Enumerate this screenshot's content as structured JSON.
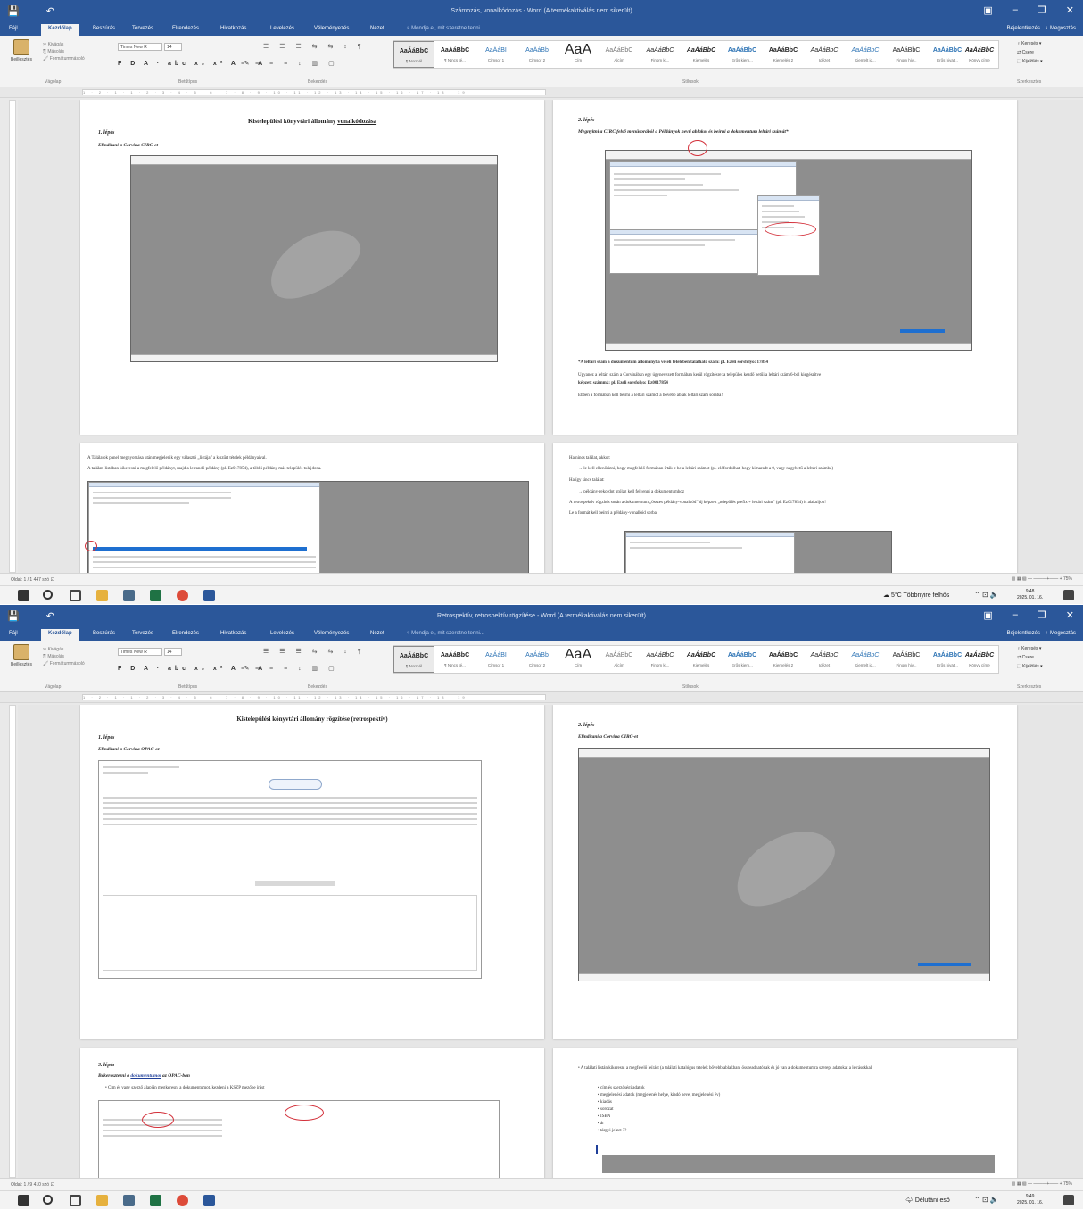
{
  "shot1": {
    "window_title": "Számozás, vonalkódozás - Word (A termékaktiválás nem sikerült)",
    "quick_access": [
      "💾",
      "↶"
    ],
    "window_controls": [
      "▣",
      "–",
      "❐",
      "✕"
    ],
    "tabs": [
      "Fájl",
      "Kezdőlap",
      "Beszúrás",
      "Tervezés",
      "Elrendezés",
      "Hivatkozás",
      "Levelezés",
      "Véleményezés",
      "Nézet"
    ],
    "tell_me": "♀ Mondja el, mit szeretne tenni...",
    "share": "Bejelentkezés",
    "share_button": "♀ Megosztás",
    "ribbon": {
      "paste": "Beillesztés",
      "clip_items": [
        "✂ Kivágás",
        "⎘ Másolás",
        "🖌 Formátummásoló"
      ],
      "font_name": "Times New R",
      "font_size": "14",
      "format_row": "F D A · abc x₂ x² A ✎ A",
      "para_row1": "☰ ☰ ☰ ⇆ ⇆ ↕ ¶",
      "para_row2": "≡ ≡ ≡ ≡ ↕ ▥ ▢",
      "styles": [
        {
          "sample": "AaÁáBbC",
          "label": "¶ Normál"
        },
        {
          "sample": "AaÁáBbC",
          "label": "¶ Nincs té..."
        },
        {
          "sample": "AaÁáBI",
          "label": "Címsor 1"
        },
        {
          "sample": "AaÁáBb",
          "label": "Címsor 2"
        },
        {
          "sample": "AaA",
          "label": "Cím"
        },
        {
          "sample": "AaÁáBbC",
          "label": "Alcím"
        },
        {
          "sample": "AaÁáBbC",
          "label": "Finom ki..."
        },
        {
          "sample": "AaÁáBbC",
          "label": "Kiemelés"
        },
        {
          "sample": "AaÁáBbC",
          "label": "Erős kiem..."
        },
        {
          "sample": "AaÁáBbC",
          "label": "Kiemelés 2"
        },
        {
          "sample": "AaÁáBbC",
          "label": "Idézet"
        },
        {
          "sample": "AaÁáBbC",
          "label": "Kiemelt id..."
        },
        {
          "sample": "AaÁáBbC",
          "label": "Finom hiv..."
        },
        {
          "sample": "AaÁáBbC",
          "label": "Erős hivat..."
        },
        {
          "sample": "AaÁáBbC",
          "label": "Könyv címe"
        }
      ],
      "editing": [
        "♀ Keresés ▾",
        "⇄ Csere",
        "⬚ Kijelölés ▾"
      ],
      "group_labels": [
        "Vágólap",
        "Betűtípus",
        "Bekezdés",
        "Stílusok",
        "Szerkesztés"
      ]
    },
    "ruler_text": "1 · 2 · 1 · 1 · 2 · 3 · 4 · 5 · 6 · 7 · 8 · 9 · 10 · 11 · 12 · 13 · 14 · 15 · 16 · 17 · 18 · 19",
    "page1": {
      "title_prefix": "Kistelepülési könyvtári állomány ",
      "title_link": "vonalkódozása",
      "step": "1. lépés",
      "sub": "Elindítani a Corvina CIRC-et"
    },
    "page2": {
      "step": "2. lépés",
      "sub": "Megnyitni a CIRC felső menüsorából a Példányok nevű ablakot és beírni a dokumentum leltári számát*",
      "notes": [
        "*A leltári szám a dokumentum állományba vételi tételében található szám: pl. Ezeli sorsfolyo: 17854",
        "Ugyanez a leltári szám a Corvinában egy úgynevezett formában kerül rögzítésre: a település kezdő betűi a leltári szám 6-ból kiegészítve",
        "képzett számmá: pl. Ezeli sorsfolyo: Ez0017854",
        "Ebben a formában kell beírni a leltári számot a bővebb ablak leltári szám sorába!"
      ]
    },
    "page3": {
      "lines": [
        "A Találatok panel megnyomása után megjelenik egy választó „listája” a kiszűrt tételek példányaival.",
        "A találati listában kikeresni a megfelelő példányt, majd a leírandó példány (pl. Ez017854), a többi példány más település tulajdona."
      ]
    },
    "page4": {
      "lines": [
        "Ha nincs találat, akkor:",
        "→ le kell ellenőrizni, hogy megfelelő formában írták-e be a leltári számot (pl. előfordulhat, hogy kimaradt a 0, vagy nagybetű a leltári számba)",
        "Ha így sincs találat:",
        "→ példány-rekordot utólag kell felvenni a dokumentumhoz",
        "A retrospektív rögzítés során a dokumentum „összes példány-vonalkód” új képzett „település prefix + leltári szám” (pl. Ez017854) is alakuljon!",
        "Le a formát kell beírni a példány-vonalkód sorba"
      ]
    },
    "status": "Oldal: 1 / 1    447 szó    ⊡",
    "status_right": "▥ ▦ ▧  —  ———+—— +  75%",
    "weather": "☁ 5°C  Többnyire felhős",
    "tray": "⌃ ⊡ 🔈",
    "clock_time": "9:48",
    "clock_date": "2025. 01. 16."
  },
  "shot2": {
    "window_title": "Retrospektív, retrospektív rögzítése - Word (A termékaktiválás nem sikerült)",
    "page1": {
      "title": "Kistelepülési könyvtári állomány rögzítése (retrospektív)",
      "step": "1. lépés",
      "sub": "Elindítani a Corvina OPAC-ot"
    },
    "page2": {
      "step": "2. lépés",
      "sub": "Elindítani a Corvina CIRC-et"
    },
    "page3": {
      "step": "3. lépés",
      "sub_prefix": "Bekeresztezni a ",
      "sub_link": "dokumentumot",
      "sub_suffix": " az OPAC-ban",
      "bullet": "• Cím és vagy szerző alapján megkeresni a dokumentumot, kezdeni a KSZP mezőbe írást"
    },
    "page4": {
      "intro": "• A találati listán kikeresni a megfelelő leírást (a találati katalógus tételek bővebb ablakban, összeadhatónak és jó van a dokumentumra szerepl adatokat a leírásokkal",
      "bullets": [
        "cím és szerzőségi adatok",
        "megjelenési adatok (megjelenés helye, kiadó neve, megjelenési év)",
        "kiadás",
        "sorozat",
        "ISBN",
        "ár",
        "tárgyi jelzet ??"
      ]
    },
    "status": "Oldal: 1 / 9    410 szó    ⊡",
    "status_right": "▥ ▦ ▧  —  ———+—— +  75%",
    "weather": "🌩 Délutáni eső",
    "tray": "⌃ ⊡ 🔈",
    "clock_time": "9:49",
    "clock_date": "2025. 01. 16."
  },
  "taskbar_apps": [
    "start-icon",
    "search-icon",
    "task-view-icon",
    "file-explorer-icon",
    "calculator-icon",
    "excel-icon",
    "chrome-icon",
    "word-icon"
  ],
  "colors": {
    "word_blue": "#2b579a",
    "annotation_red": "#d3303a",
    "selection_blue": "#1e6fd0"
  }
}
